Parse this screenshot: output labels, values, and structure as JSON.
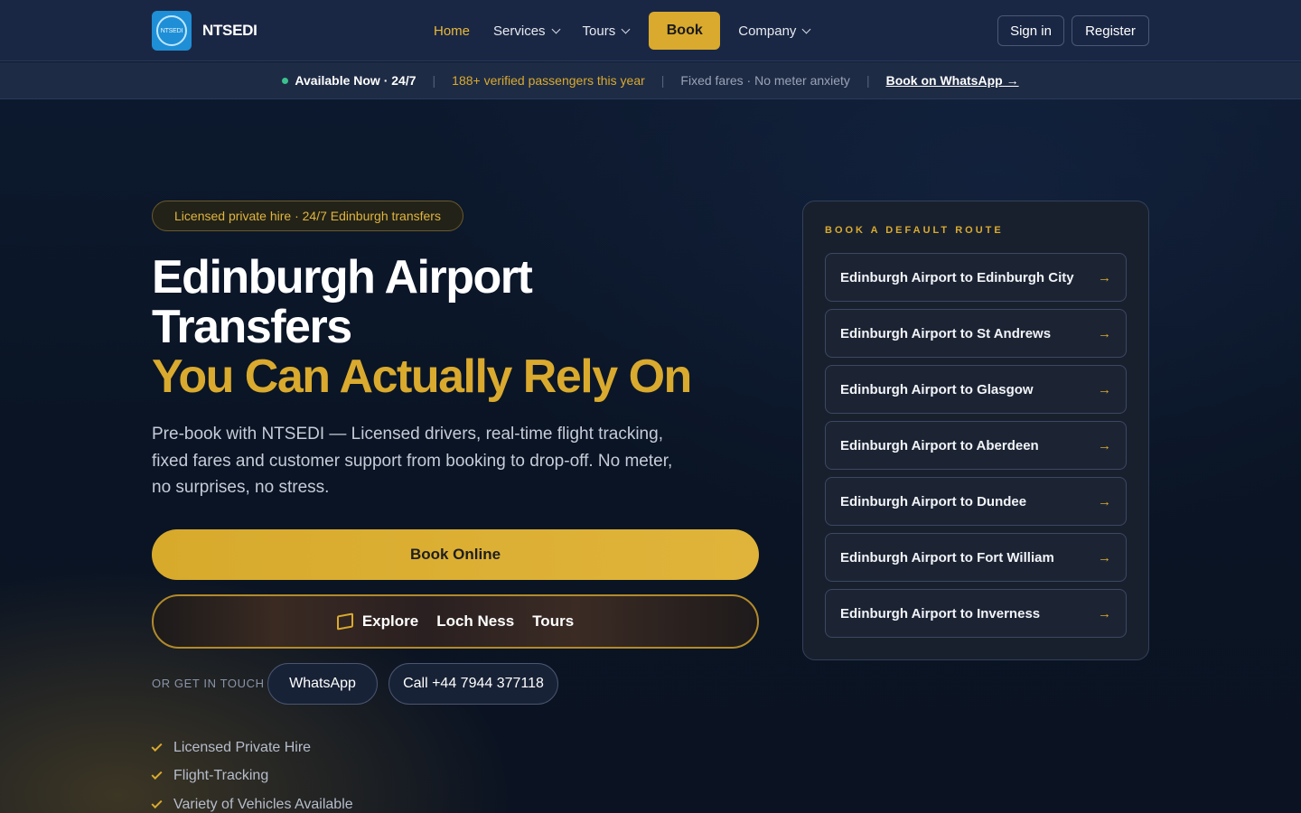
{
  "brand": {
    "name": "NTSEDI",
    "logo_text": "NTSEDI"
  },
  "nav": {
    "home": "Home",
    "services": "Services",
    "tours": "Tours",
    "book": "Book",
    "company": "Company",
    "signin": "Sign in",
    "register": "Register"
  },
  "infobar": {
    "available": "Available Now · 24/7",
    "passengers": "188+ verified passengers this year",
    "fares": "Fixed fares · No meter anxiety",
    "whatsapp": "Book on WhatsApp →",
    "separator": "|"
  },
  "hero": {
    "badge": "Licensed private hire · 24/7 Edinburgh transfers",
    "title_line1": "Edinburgh Airport",
    "title_line2": "Transfers",
    "title_line3": "You Can Actually Rely On",
    "lead": "Pre-book with NTSEDI — Licensed drivers, real-time flight tracking, fixed fares and customer support from booking to drop-off. No meter, no surprises, no stress.",
    "book_online": "Book Online",
    "explore_words": [
      "Explore",
      "Loch Ness",
      "Tours"
    ],
    "touch_label": "OR GET IN TOUCH",
    "whatsapp": "WhatsApp",
    "call": "Call +44 7944 377118",
    "features": [
      "Licensed Private Hire",
      "Flight-Tracking",
      "Variety of Vehicles Available"
    ]
  },
  "routes_panel": {
    "title": "BOOK A DEFAULT ROUTE",
    "arrow": "→",
    "routes": [
      "Edinburgh Airport to Edinburgh City",
      "Edinburgh Airport to St Andrews",
      "Edinburgh Airport to Glasgow",
      "Edinburgh Airport to Aberdeen",
      "Edinburgh Airport to Dundee",
      "Edinburgh Airport to Fort William",
      "Edinburgh Airport to Inverness"
    ]
  },
  "colors": {
    "accent": "#d9aa2e",
    "header": "#1a2744",
    "background": "#0c1628",
    "status": "#3bc18e"
  }
}
